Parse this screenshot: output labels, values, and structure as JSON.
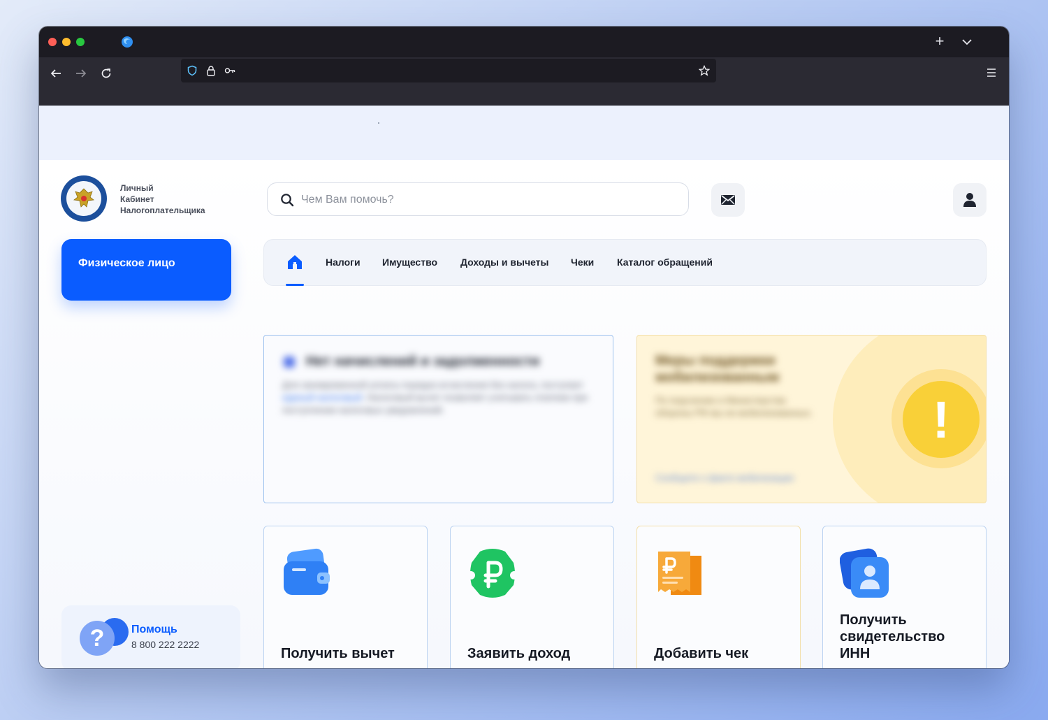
{
  "browser": {
    "icons": {
      "back": "arrow-left-icon",
      "forward": "arrow-right-icon",
      "reload": "reload-icon",
      "tracking": "shield-icon",
      "lock": "lock-icon",
      "key": "key-icon",
      "bookmark": "star-icon",
      "menu": "hamburger-icon",
      "new_tab": "plus-icon",
      "tab_list": "chevron-down-icon"
    },
    "new_tab_glyph": "+"
  },
  "header": {
    "logo_lines": [
      "Личный",
      "Кабинет",
      "Налогоплательщика"
    ],
    "search_placeholder": "Чем Вам помочь?",
    "mail_icon": "envelope-icon",
    "user_icon": "user-icon"
  },
  "sidebar": {
    "role_label": "Физическое лицо",
    "help": {
      "title": "Помощь",
      "phone": "8 800 222 2222",
      "icon_glyph": "?"
    }
  },
  "nav": {
    "home_icon": "home-icon",
    "tabs": [
      {
        "label": "Налоги"
      },
      {
        "label": "Имущество"
      },
      {
        "label": "Доходы и вычеты"
      },
      {
        "label": "Чеки"
      },
      {
        "label": "Каталог обращений"
      }
    ]
  },
  "cards": {
    "info": {
      "title": "Нет начислений и задолженности",
      "text_before_link": "Для своевременной уплаты порядок исчисления без налога, поступает",
      "link": "единый налоговый",
      "text_after_link": ". Налоговый вычет позволяет учитывать платежи при поступлении налоговых уведомлений.",
      "accent": "#9ec2ee"
    },
    "warning": {
      "title": "Меры поддержки мобилизованным",
      "text": "По поручению и Министерства обороны РФ мы не мобилизованных.",
      "link": "Сообщите о факте мобилизации",
      "icon_glyph": "!",
      "accent": "#f9d038"
    }
  },
  "actions": [
    {
      "title": "Получить вычет",
      "icon": "wallet-icon",
      "color": "#2f80f5"
    },
    {
      "title": "Заявить доход",
      "icon": "ruble-icon",
      "color": "#1fc462"
    },
    {
      "title": "Добавить чек",
      "icon": "receipt-icon",
      "color": "#f59a1e"
    },
    {
      "title": "Получить свидетельство ИНН",
      "icon": "id-card-icon",
      "color": "#2f7af5"
    }
  ],
  "colors": {
    "brand_blue": "#0a5cff",
    "background": "#f6f8fd"
  }
}
